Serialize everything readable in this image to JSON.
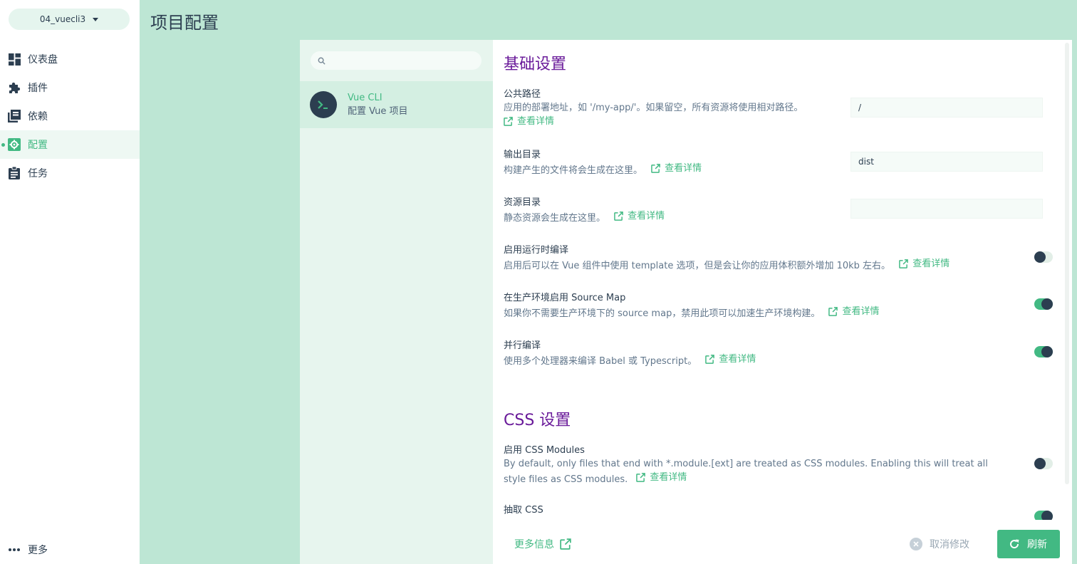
{
  "sidebar": {
    "project": "04_vuecli3",
    "items": [
      {
        "label": "仪表盘",
        "icon": "dashboard-icon",
        "active": false
      },
      {
        "label": "插件",
        "icon": "puzzle-icon",
        "active": false
      },
      {
        "label": "依赖",
        "icon": "library-icon",
        "active": false
      },
      {
        "label": "配置",
        "icon": "gear-icon",
        "active": true
      },
      {
        "label": "任务",
        "icon": "clipboard-icon",
        "active": false
      }
    ],
    "more": "更多"
  },
  "page": {
    "title": "项目配置"
  },
  "config_list": {
    "search_placeholder": "",
    "item": {
      "name": "Vue CLI",
      "description": "配置 Vue 项目"
    }
  },
  "sections": {
    "basic": {
      "title": "基础设置",
      "prompts": [
        {
          "label": "公共路径",
          "desc": "应用的部署地址，如 '/my-app/'。如果留空，所有资源将使用相对路径。",
          "link": "查看详情",
          "value": "/"
        },
        {
          "label": "输出目录",
          "desc": "构建产生的文件将会生成在这里。",
          "link": "查看详情",
          "value": "dist"
        },
        {
          "label": "资源目录",
          "desc": "静态资源会生成在这里。",
          "link": "查看详情",
          "value": ""
        },
        {
          "label": "启用运行时编译",
          "desc": "启用后可以在 Vue 组件中使用 template 选项，但是会让你的应用体积额外增加 10kb 左右。",
          "link": "查看详情",
          "enabled": false
        },
        {
          "label": "在生产环境启用 Source Map",
          "desc": "如果你不需要生产环境下的 source map，禁用此项可以加速生产环境构建。",
          "link": "查看详情",
          "enabled": true
        },
        {
          "label": "并行编译",
          "desc": "使用多个处理器来编译 Babel 或 Typescript。",
          "link": "查看详情",
          "enabled": true
        }
      ]
    },
    "css": {
      "title": "CSS 设置",
      "prompts": [
        {
          "label": "启用 CSS Modules",
          "desc": "By default, only files that end with *.module.[ext] are treated as CSS modules. Enabling this will treat all style files as CSS modules.",
          "link": "查看详情",
          "enabled": false
        },
        {
          "label": "抽取 CSS",
          "desc": "",
          "enabled": true
        }
      ]
    }
  },
  "footer": {
    "more_info": "更多信息",
    "cancel": "取消修改",
    "refresh": "刷新"
  },
  "colors": {
    "accent": "#42b983",
    "dark": "#2c3e50",
    "section": "#6a1b9a",
    "background": "#bde6d4"
  }
}
